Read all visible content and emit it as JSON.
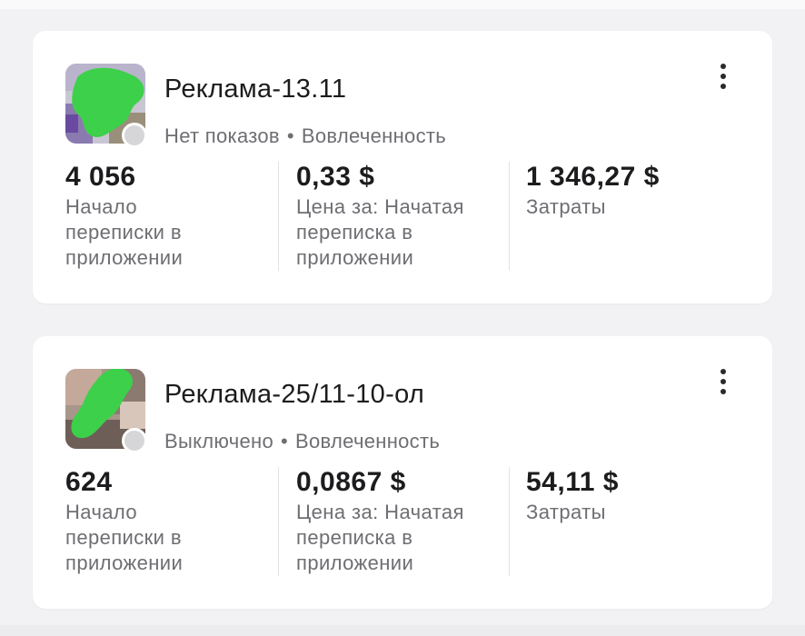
{
  "ads": [
    {
      "title": "Реклама-13.11",
      "status": "Нет показов",
      "separator": "•",
      "objective": "Вовлеченность",
      "metrics": [
        {
          "value": "4 056",
          "label": "Начало переписки в приложении"
        },
        {
          "value": "0,33 $",
          "label": "Цена за: Начатая переписка в приложении"
        },
        {
          "value": "1 346,27 $",
          "label": "Затраты"
        }
      ]
    },
    {
      "title": "Реклама-25/11-10-ол",
      "status": "Выключено",
      "separator": "•",
      "objective": "Вовлеченность",
      "metrics": [
        {
          "value": "624",
          "label": "Начало переписки в приложении"
        },
        {
          "value": "0,0867 $",
          "label": "Цена за: Начатая переписка в приложении"
        },
        {
          "value": "54,11 $",
          "label": "Затраты"
        }
      ]
    }
  ],
  "icons": {
    "menu": "more-vertical-icon",
    "status": "status-dot-icon"
  },
  "colors": {
    "background": "#f2f2f4",
    "card": "#ffffff",
    "primary_text": "#1c1c1e",
    "secondary_text": "#6e6e73",
    "status_dot": "#d6d6d9",
    "redaction_green": "#3dd04a"
  }
}
